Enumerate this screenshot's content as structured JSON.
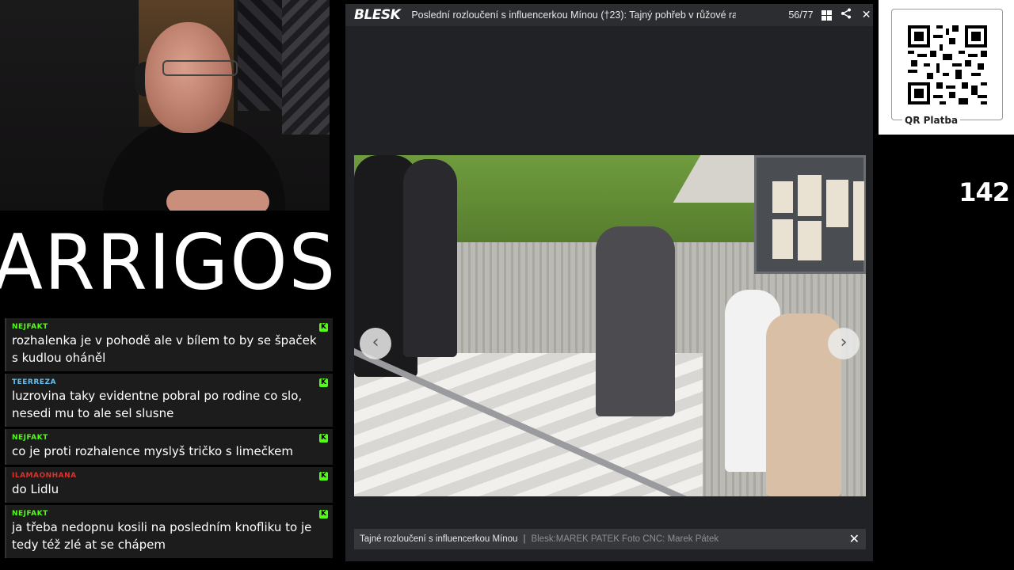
{
  "logo": {
    "text": "ARRIGOS"
  },
  "chat": [
    {
      "user": "NEJFAKT",
      "user_color": "#53fc18",
      "text": "rozhalenka je v pohodě ale v bílem to by se špaček s kudlou oháněl"
    },
    {
      "user": "TEERREZA",
      "user_color": "#5fc2f5",
      "text": "luzrovina taky evidentne pobral po rodine co slo, nesedi mu to ale sel slusne"
    },
    {
      "user": "NEJFAKT",
      "user_color": "#53fc18",
      "text": "co je proti rozhalence myslyš tričko s limečkem"
    },
    {
      "user": "ILAMAONHANA",
      "user_color": "#e0312b",
      "text": "do Lidlu"
    },
    {
      "user": "NEJFAKT",
      "user_color": "#53fc18",
      "text": "ja třeba nedopnu kosili na posledním knofliku to je tedy též zlé at se chápem"
    }
  ],
  "viewer": {
    "brand": "BLESK",
    "title": "Poslední rozloučení s influencerkou Mínou (†23): Tajný pohřeb v růžové ra...",
    "counter": "56/77",
    "caption": "Tajné rozloučení s influencerkou Mínou",
    "separator": "|",
    "credit": "Blesk:MAREK PATEK Foto CNC: Marek Pátek"
  },
  "qr": {
    "label": "QR Platba"
  },
  "side_number": "142",
  "colors": {
    "accent_kick": "#53fc18",
    "viewer_bg": "#202225"
  }
}
